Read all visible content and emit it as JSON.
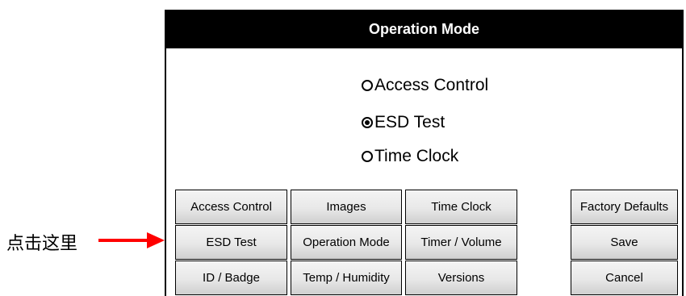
{
  "panel": {
    "title": "Operation Mode"
  },
  "radio_options": [
    {
      "label": "Access Control",
      "selected": false
    },
    {
      "label": "ESD Test",
      "selected": true
    },
    {
      "label": "Time Clock",
      "selected": false
    }
  ],
  "buttons": {
    "col1": [
      "Access Control",
      "ESD Test",
      "ID / Badge"
    ],
    "col2": [
      "Images",
      "Operation Mode",
      "Temp / Humidity"
    ],
    "col3": [
      "Time Clock",
      "Timer / Volume",
      "Versions"
    ],
    "col4": [
      "Factory Defaults",
      "Save",
      "Cancel"
    ]
  },
  "annotation": {
    "label": "点击这里",
    "arrow_color": "#ff0000",
    "icon": "arrow-right-icon"
  },
  "colors": {
    "title_bar_bg": "#000000",
    "title_bar_text": "#ffffff",
    "button_border": "#000000"
  }
}
